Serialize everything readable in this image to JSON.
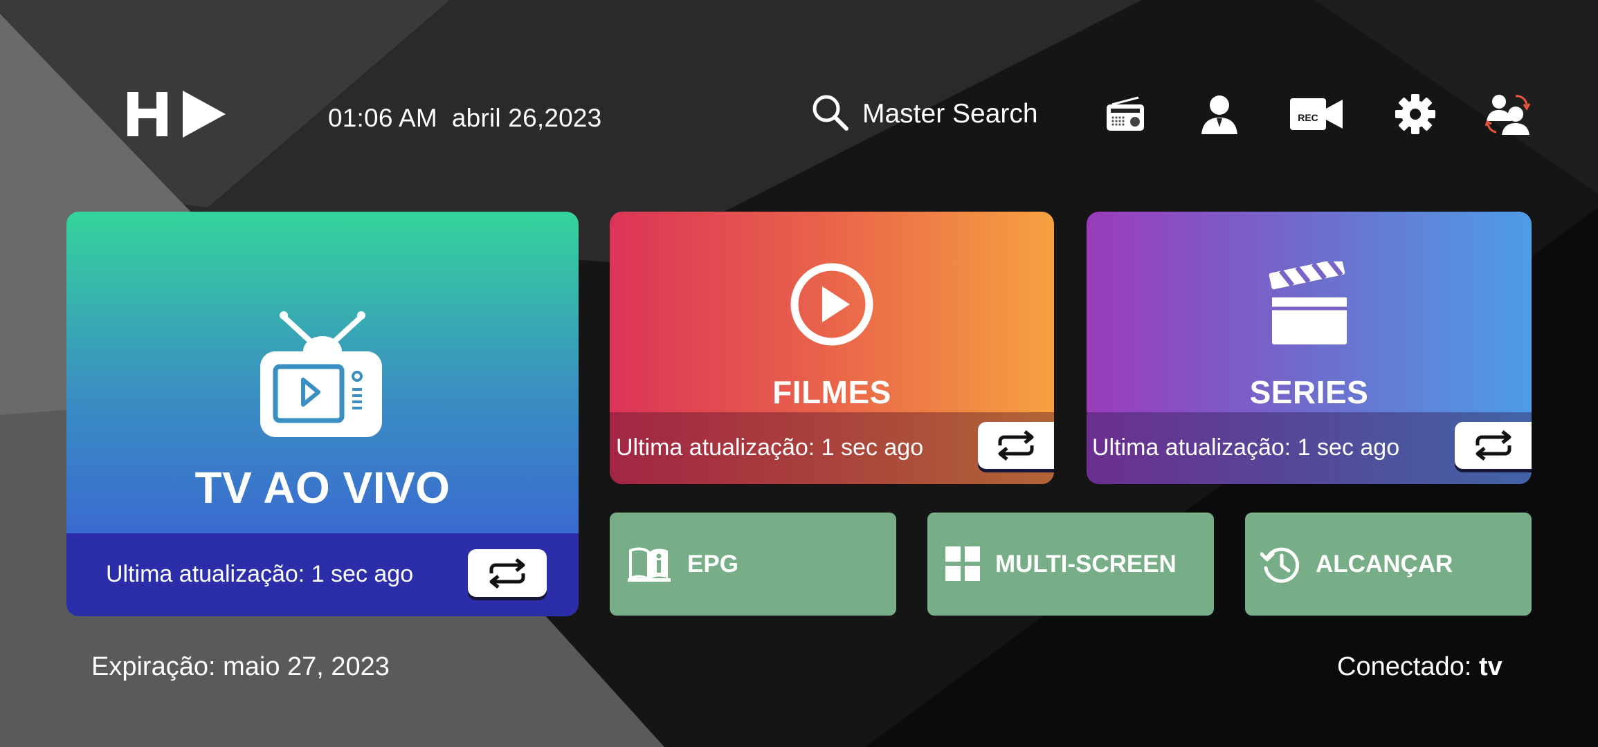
{
  "header": {
    "time": "01:06 AM",
    "date": "abril 26,2023",
    "search_label": "Master Search",
    "icons": [
      "radio-icon",
      "user-icon",
      "rec-camera-icon",
      "gear-icon",
      "switch-user-icon"
    ],
    "rec_label": "REC"
  },
  "tiles": {
    "live": {
      "title": "TV AO VIVO",
      "updated": "Ultima atualização: 1 sec ago"
    },
    "movies": {
      "title": "FILMES",
      "updated": "Ultima atualização: 1 sec ago"
    },
    "series": {
      "title": "SERIES",
      "updated": "Ultima atualização: 1 sec ago"
    }
  },
  "shortcuts": [
    {
      "label": "EPG",
      "icon": "book-info-icon"
    },
    {
      "label": "MULTI-SCREEN",
      "icon": "grid-icon"
    },
    {
      "label": "ALCANÇAR",
      "icon": "history-icon"
    }
  ],
  "footer": {
    "expiration": "Expiração: maio 27, 2023",
    "connected_label": "Conectado:",
    "connected_value": "tv"
  },
  "colors": {
    "live_gradient": [
      "#35d49b",
      "#3a55d8"
    ],
    "movies_gradient": [
      "#dc3458",
      "#f6a141"
    ],
    "series_gradient": [
      "#9b3cb9",
      "#4e9de6"
    ],
    "shortcut_bg": "#77ae88",
    "background": "#141414"
  }
}
